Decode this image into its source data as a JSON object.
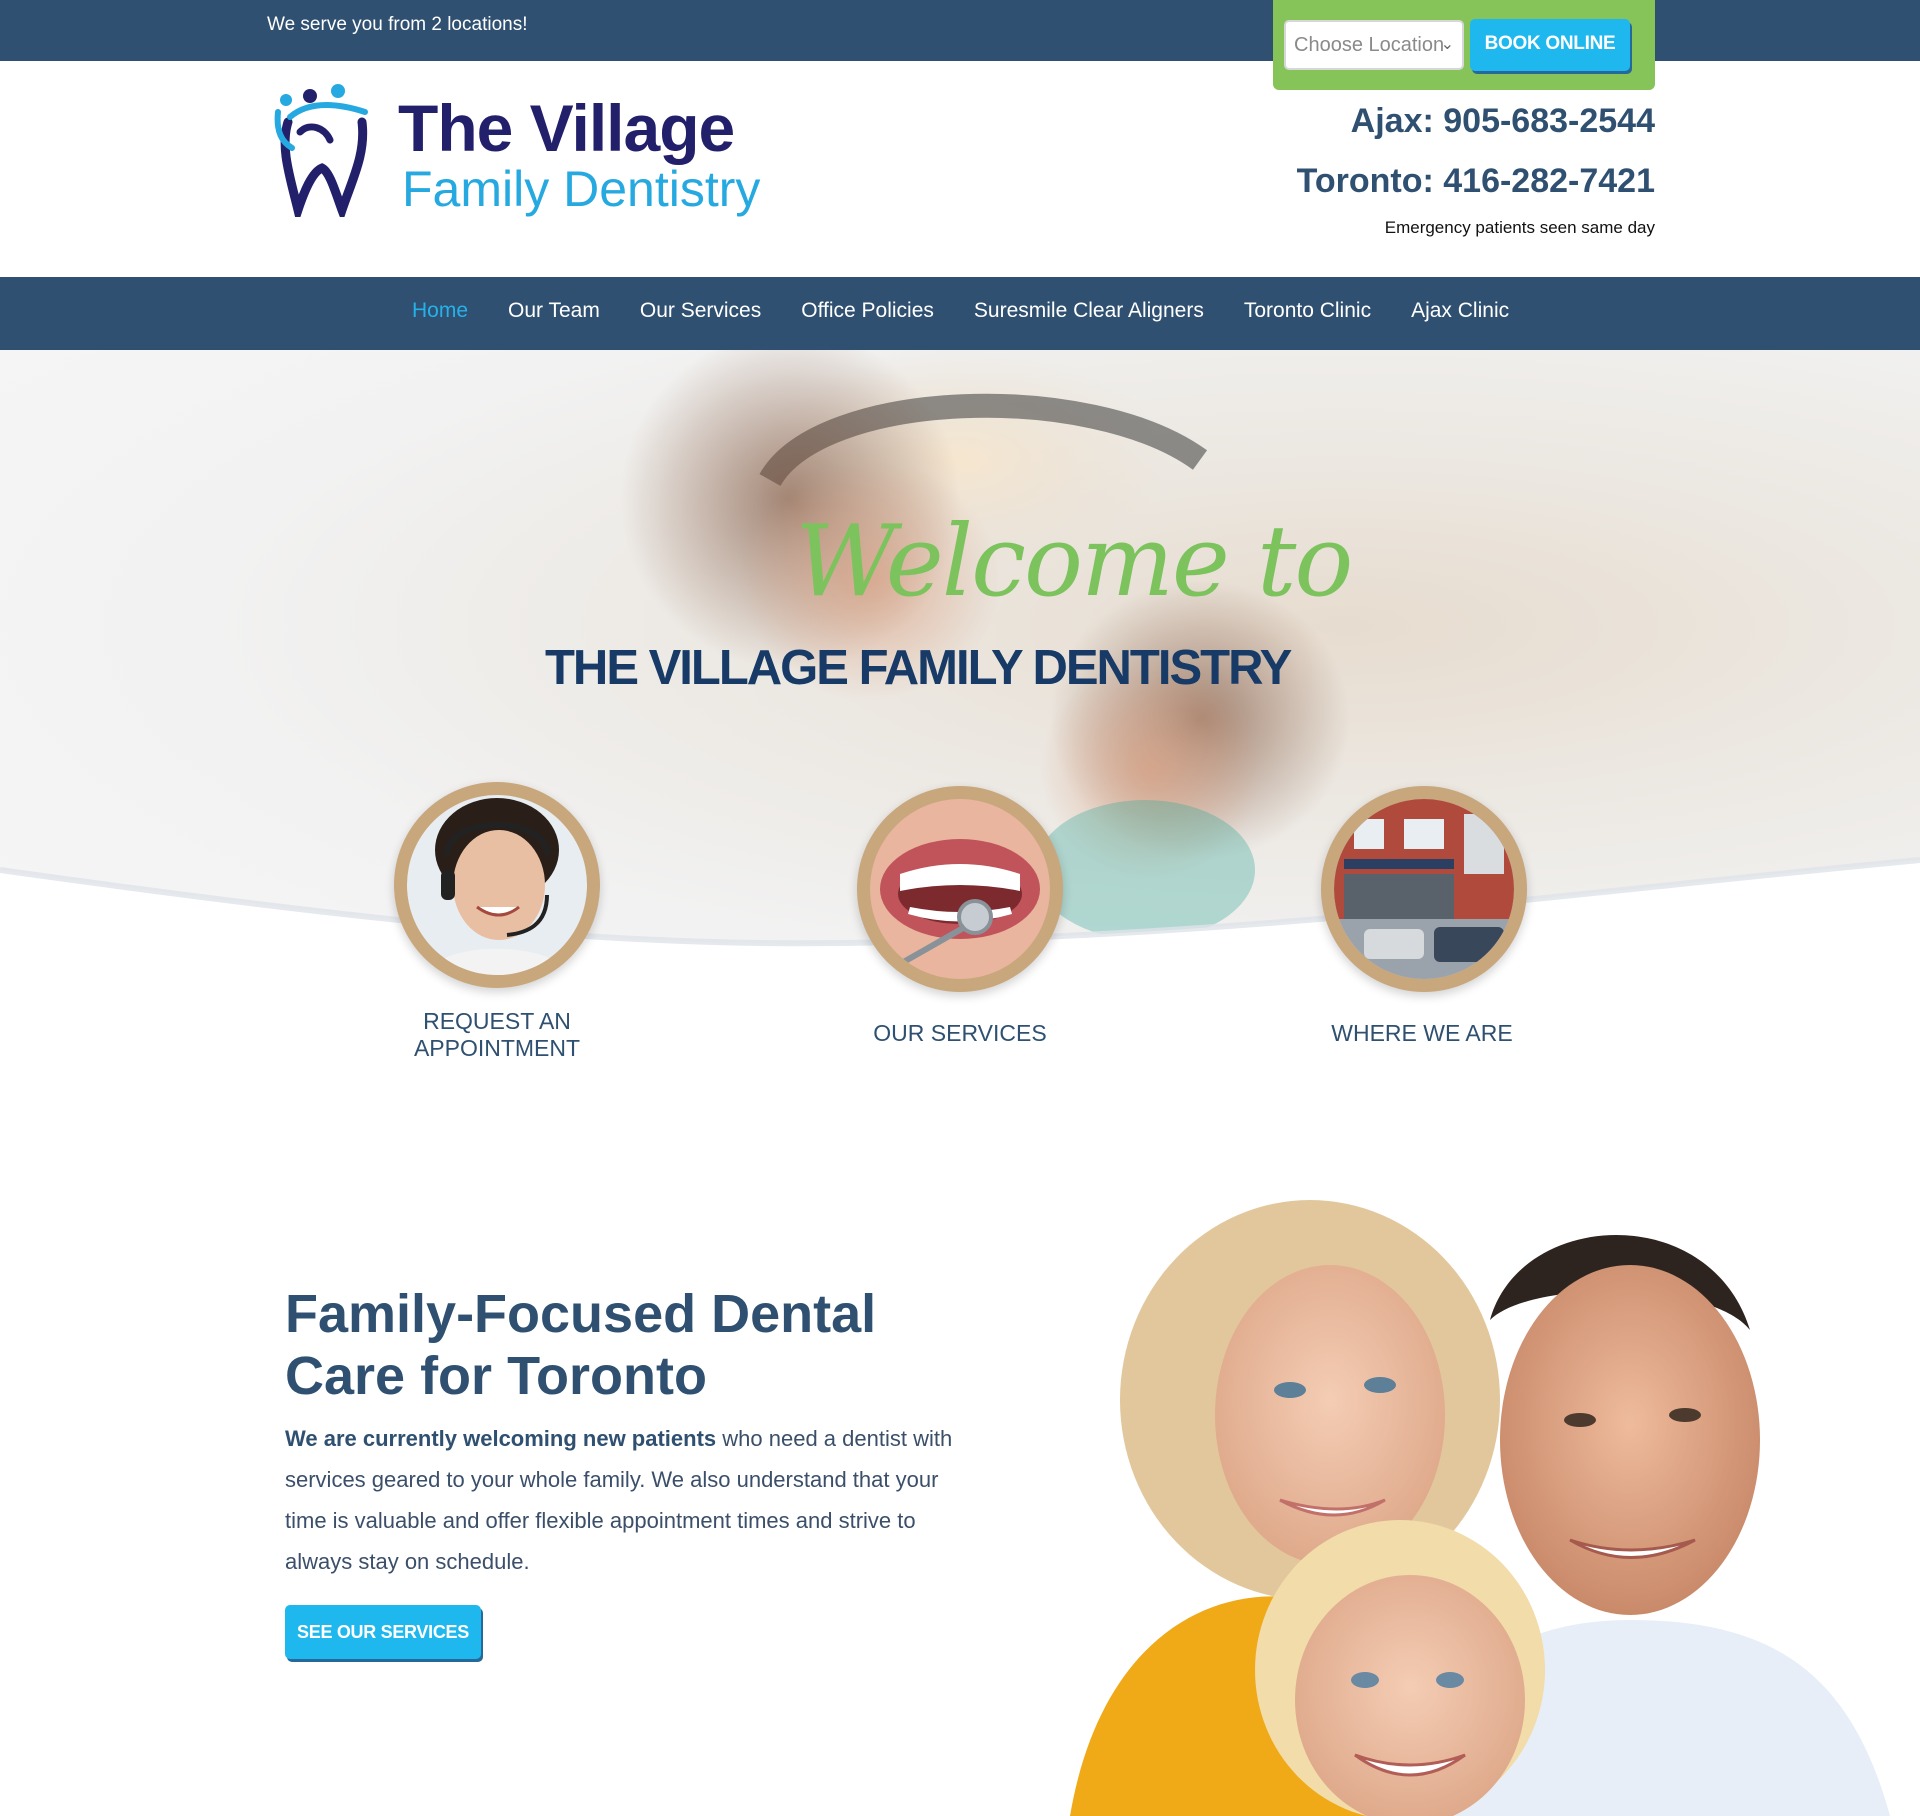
{
  "topbar": {
    "tagline": "We serve you from 2 locations!",
    "location_select": "Choose Location",
    "book_button": "BOOK ONLINE"
  },
  "header": {
    "logo_line1": "The Village",
    "logo_line2": "Family Dentistry",
    "phone_ajax": "Ajax: 905-683-2544",
    "phone_toronto": "Toronto: 416-282-7421",
    "emergency_note": "Emergency patients seen same day"
  },
  "nav": {
    "items": [
      {
        "label": "Home"
      },
      {
        "label": "Our Team"
      },
      {
        "label": "Our Services"
      },
      {
        "label": "Office Policies"
      },
      {
        "label": "Suresmile Clear Aligners"
      },
      {
        "label": "Toronto Clinic"
      },
      {
        "label": "Ajax Clinic"
      }
    ]
  },
  "hero": {
    "welcome": "Welcome to",
    "brand": "THE VILLAGE FAMILY DENTISTRY",
    "features": [
      {
        "line1": "REQUEST AN",
        "line2": "APPOINTMENT"
      },
      {
        "line1": "OUR SERVICES"
      },
      {
        "line1": "WHERE WE ARE"
      }
    ]
  },
  "intro": {
    "heading_line1": "Family-Focused Dental",
    "heading_line2": "Care for Toronto",
    "bold_lead": "We are currently welcoming new patients",
    "body": " who need a dentist with services geared to your whole family. We also understand that your time is valuable and offer flexible appointment times and strive to always stay on schedule.",
    "button": "SEE OUR SERVICES"
  },
  "colors": {
    "navy": "#2f5070",
    "accent_blue": "#1fb8ee",
    "accent_green": "#86c45a",
    "logo_navy": "#23206b",
    "logo_blue": "#26a9e0"
  }
}
